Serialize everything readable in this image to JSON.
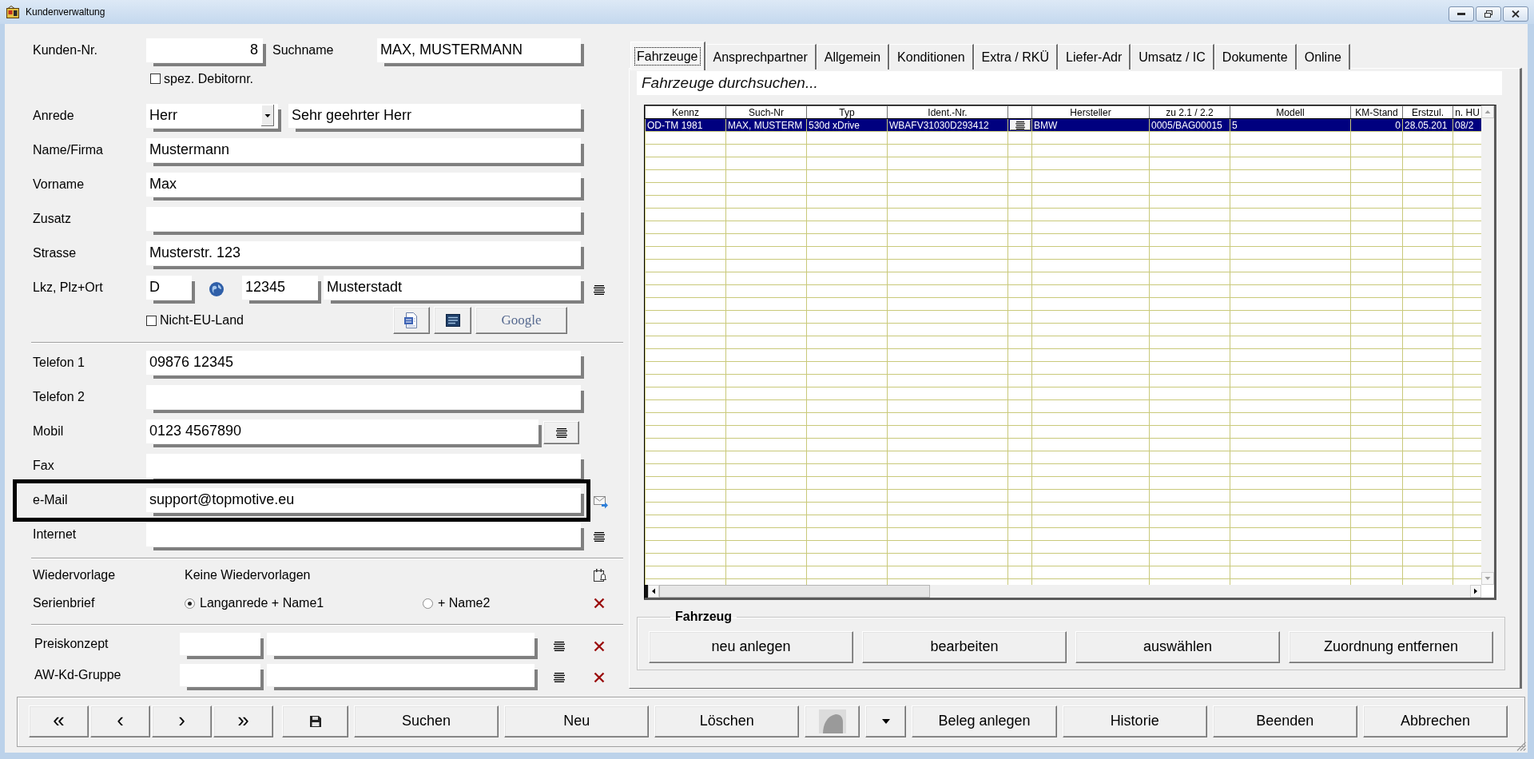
{
  "window": {
    "title": "Kundenverwaltung"
  },
  "customer": {
    "number": {
      "label": "Kunden-Nr.",
      "value": "8"
    },
    "search_name": {
      "label": "Suchname",
      "value": "MAX, MUSTERMANN"
    },
    "special_debtor": {
      "label": "spez. Debitornr.",
      "checked": false
    },
    "salutation": {
      "label": "Anrede",
      "value": "Herr",
      "letter": "Sehr geehrter Herr"
    },
    "fields": [
      {
        "label": "Name/Firma",
        "value": "Mustermann"
      },
      {
        "label": "Vorname",
        "value": "Max"
      },
      {
        "label": "Zusatz"
      },
      {
        "label": "Strasse",
        "value": "Musterstr. 123"
      }
    ],
    "address": {
      "label": "Lkz, Plz+Ort",
      "country": "D",
      "zip": "12345",
      "city": "Musterstadt"
    },
    "non_eu": {
      "label": "Nicht-EU-Land",
      "checked": false
    },
    "map_buttons": [
      {
        "kind": "document"
      },
      {
        "kind": "stack"
      },
      {
        "kind": "map",
        "label": "Google"
      }
    ]
  },
  "contact": [
    {
      "label": "Telefon 1",
      "value": "09876 12345",
      "kind": "plain",
      "highlighted": false
    },
    {
      "label": "Telefon 2",
      "kind": "plain",
      "highlighted": false
    },
    {
      "label": "Mobil",
      "value": "0123 4567890",
      "kind": "list_button",
      "highlighted": false
    },
    {
      "label": "Fax",
      "kind": "plain",
      "highlighted": false
    },
    {
      "label": "e-Mail",
      "value": "support@topmotive.eu",
      "kind": "mail",
      "highlighted": true
    },
    {
      "label": "Internet",
      "kind": "list",
      "highlighted": false
    }
  ],
  "follow_up": {
    "label": "Wiedervorlage",
    "value": "Keine Wiedervorlagen"
  },
  "serial_letter": {
    "label": "Serienbrief",
    "options": [
      {
        "label": "Langanrede + Name1",
        "selected": true
      },
      {
        "label": "+ Name2",
        "selected": false
      }
    ]
  },
  "groups": [
    {
      "label": "Preiskonzept"
    },
    {
      "label": "AW-Kd-Gruppe"
    }
  ],
  "tabs": [
    {
      "label": "Fahrzeuge",
      "selected": true
    },
    {
      "label": "Ansprechpartner",
      "selected": false
    },
    {
      "label": "Allgemein",
      "selected": false
    },
    {
      "label": "Konditionen",
      "selected": false
    },
    {
      "label": "Extra / RKÜ",
      "selected": false
    },
    {
      "label": "Liefer-Adr",
      "selected": false
    },
    {
      "label": "Umsatz / IC",
      "selected": false
    },
    {
      "label": "Dokumente",
      "selected": false
    },
    {
      "label": "Online",
      "selected": false
    }
  ],
  "vehicles": {
    "search": {
      "placeholder": "Fahrzeuge durchsuchen..."
    },
    "columns": [
      {
        "label": "Kennz",
        "kind": "text"
      },
      {
        "label": "Such-Nr",
        "kind": "text"
      },
      {
        "label": "Typ",
        "kind": "text"
      },
      {
        "label": "Ident.-Nr.",
        "kind": "text"
      },
      {
        "kind": "button"
      },
      {
        "label": "Hersteller",
        "kind": "text"
      },
      {
        "label": "zu 2.1 / 2.2",
        "kind": "text"
      },
      {
        "label": "Modell",
        "kind": "text"
      },
      {
        "label": "KM-Stand",
        "kind": "number"
      },
      {
        "label": "Erstzul.",
        "kind": "text"
      },
      {
        "label": "n. HU",
        "kind": "text"
      }
    ],
    "rows": [
      {
        "selected": true,
        "cells": [
          "OD-TM 1981",
          "MAX, MUSTERM",
          "530d xDrive",
          "WBAFV31030D293412",
          {
            "kind": "button"
          },
          "BMW",
          "0005/BAG00015",
          "5",
          "0",
          "28.05.201",
          "08/2"
        ]
      }
    ],
    "group": {
      "title": "Fahrzeug",
      "buttons": [
        "neu anlegen",
        "bearbeiten",
        "auswählen",
        "Zuordnung entfernen"
      ]
    }
  },
  "toolbar": [
    {
      "kind": "nav",
      "label": "«"
    },
    {
      "kind": "nav",
      "label": "‹"
    },
    {
      "kind": "nav",
      "label": "›"
    },
    {
      "kind": "nav",
      "label": "»"
    },
    {
      "kind": "save"
    },
    {
      "kind": "text",
      "label": "Suchen"
    },
    {
      "kind": "text",
      "label": "Neu"
    },
    {
      "kind": "text",
      "label": "Löschen"
    },
    {
      "kind": "image",
      "disabled": true
    },
    {
      "kind": "dropdown"
    },
    {
      "kind": "text",
      "label": "Beleg anlegen"
    },
    {
      "kind": "text",
      "label": "Historie"
    },
    {
      "kind": "text",
      "label": "Beenden"
    },
    {
      "kind": "text",
      "label": "Abbrechen"
    }
  ]
}
